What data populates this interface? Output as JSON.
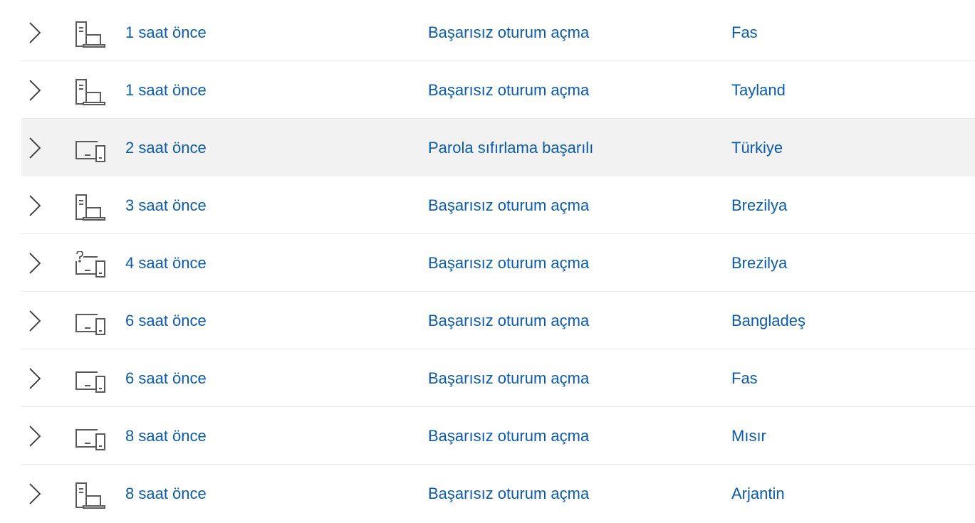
{
  "colors": {
    "link": "#0a5bb0",
    "icon": "#5a5a5a",
    "selected_row_bg": "#f2f2f2",
    "divider": "#e8e8e8"
  },
  "rows": [
    {
      "time": "1 saat önce",
      "event": "Başarısız oturum açma",
      "location": "Fas",
      "device_icon": "desktop-laptop-icon"
    },
    {
      "time": "1 saat önce",
      "event": "Başarısız oturum açma",
      "location": "Tayland",
      "device_icon": "desktop-laptop-icon"
    },
    {
      "time": "2 saat önce",
      "event": "Parola sıfırlama başarılı",
      "location": "Türkiye",
      "device_icon": "devices-icon",
      "selected": true
    },
    {
      "time": "3 saat önce",
      "event": "Başarısız oturum açma",
      "location": "Brezilya",
      "device_icon": "desktop-laptop-icon"
    },
    {
      "time": "4 saat önce",
      "event": "Başarısız oturum açma",
      "location": "Brezilya",
      "device_icon": "unknown-device-icon"
    },
    {
      "time": "6 saat önce",
      "event": "Başarısız oturum açma",
      "location": "Bangladeş",
      "device_icon": "devices-icon"
    },
    {
      "time": "6 saat önce",
      "event": "Başarısız oturum açma",
      "location": "Fas",
      "device_icon": "devices-icon"
    },
    {
      "time": "8 saat önce",
      "event": "Başarısız oturum açma",
      "location": "Mısır",
      "device_icon": "devices-icon"
    },
    {
      "time": "8 saat önce",
      "event": "Başarısız oturum açma",
      "location": "Arjantin",
      "device_icon": "desktop-laptop-icon"
    }
  ]
}
